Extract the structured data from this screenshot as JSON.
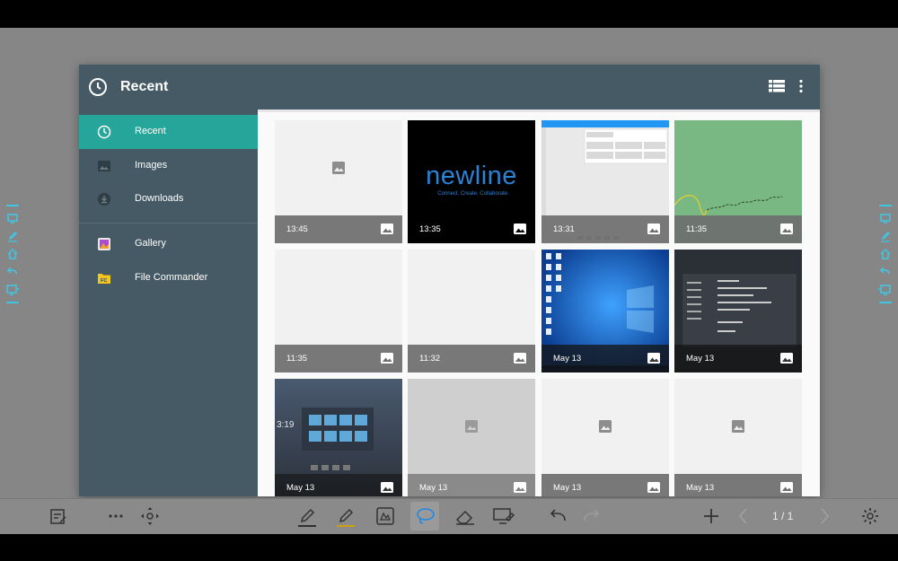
{
  "app": {
    "title": "Recent"
  },
  "drawer": {
    "items": [
      {
        "label": "Recent",
        "icon": "clock-icon",
        "active": true
      },
      {
        "label": "Images",
        "icon": "image-icon",
        "active": false
      },
      {
        "label": "Downloads",
        "icon": "download-icon",
        "active": false
      },
      {
        "label": "Gallery",
        "icon": "gallery-app-icon",
        "active": false
      },
      {
        "label": "File Commander",
        "icon": "file-commander-icon",
        "active": false
      }
    ]
  },
  "grid": {
    "items": [
      {
        "time": "13:45",
        "content": "placeholder"
      },
      {
        "time": "13:35",
        "content": "newline-logo"
      },
      {
        "time": "13:31",
        "content": "app-window-screenshot"
      },
      {
        "time": "11:35",
        "content": "green-drawing"
      },
      {
        "time": "11:35",
        "content": "blank"
      },
      {
        "time": "11:32",
        "content": "blank"
      },
      {
        "time": "May 13",
        "content": "windows-desktop"
      },
      {
        "time": "May 13",
        "content": "dark-settings-screenshot"
      },
      {
        "time": "May 13",
        "content": "dark-launcher-screenshot"
      },
      {
        "time": "May 13",
        "content": "placeholder-dimmed"
      },
      {
        "time": "May 13",
        "content": "placeholder"
      },
      {
        "time": "May 13",
        "content": "placeholder"
      }
    ]
  },
  "newline_logo": {
    "word": "newline",
    "tagline": "Connect. Create. Collaborate."
  },
  "launcher_thumb": {
    "clock": "3:19"
  },
  "pager": {
    "text": "1 / 1"
  },
  "colors": {
    "appbar": "#455a64",
    "accent": "#26a69a",
    "sidetool": "#3ec7e5"
  }
}
